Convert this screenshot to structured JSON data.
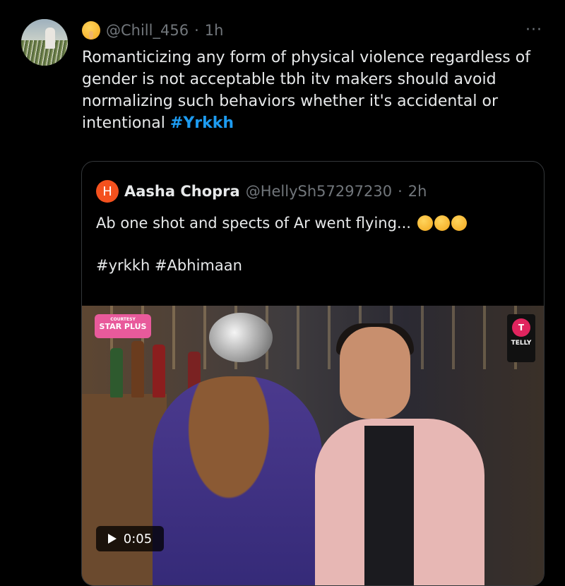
{
  "tweet": {
    "handle": "@Chill_456",
    "separator": "·",
    "time": "1h",
    "more": "···",
    "text": "Romanticizing any form of physical violence regardless of gender is not acceptable tbh itv makers should avoid normalizing such behaviors whether it's accidental or intentional ",
    "hashtag": "#Yrkkh"
  },
  "quote": {
    "avatar_letter": "H",
    "name": "Aasha Chopra",
    "handle": "@HellySh57297230",
    "separator": "·",
    "time": "2h",
    "text": "Ab one shot and spects of Ar went flying...",
    "hashtags": "#yrkkh #Abhimaan",
    "video": {
      "duration": "0:05",
      "badge_left_small": "COURTESY",
      "badge_left": "STAR PLUS",
      "badge_right_logo": "T",
      "badge_right": "TELLY"
    }
  },
  "colors": {
    "accent": "#1d9bf0",
    "background": "#000000",
    "muted": "#71767b"
  },
  "icons": [
    "shushing-face-emoji",
    "more-icon",
    "play-icon",
    "laughing-emoji"
  ]
}
